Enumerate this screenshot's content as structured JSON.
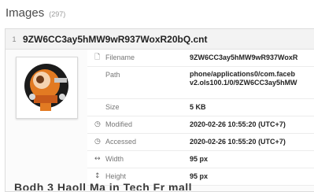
{
  "header": {
    "title": "Images",
    "count": "(297)"
  },
  "item": {
    "index": "1",
    "filename": "9ZW6CC3ay5hMW9wR937WoxR20bQ.cnt"
  },
  "props": {
    "filename": {
      "label": "Filename",
      "value": "9ZW6CC3ay5hMW9wR937WoxR"
    },
    "path": {
      "label": "Path",
      "value_line1": "phone/applications0/com.faceb",
      "value_line2": "v2.ols100.1/0/9ZW6CC3ay5hMW"
    },
    "size": {
      "label": "Size",
      "value": "5 KB"
    },
    "modified": {
      "label": "Modified",
      "value": "2020-02-26 10:55:20 (UTC+7)"
    },
    "accessed": {
      "label": "Accessed",
      "value": "2020-02-26 10:55:20 (UTC+7)"
    },
    "width": {
      "label": "Width",
      "value": "95 px"
    },
    "height": {
      "label": "Height",
      "value": "95 px"
    }
  },
  "overlay_caption": "Bodh 3 Haoll Ma in Tech Fr mall",
  "icons": {
    "filename": "file-icon",
    "modified": "clock-icon",
    "accessed": "clock-icon",
    "width": "horizontal-arrows-icon",
    "height": "vertical-arrow-icon"
  },
  "colors": {
    "accent": "#e06a1b",
    "text": "#222222",
    "muted": "#777777"
  }
}
